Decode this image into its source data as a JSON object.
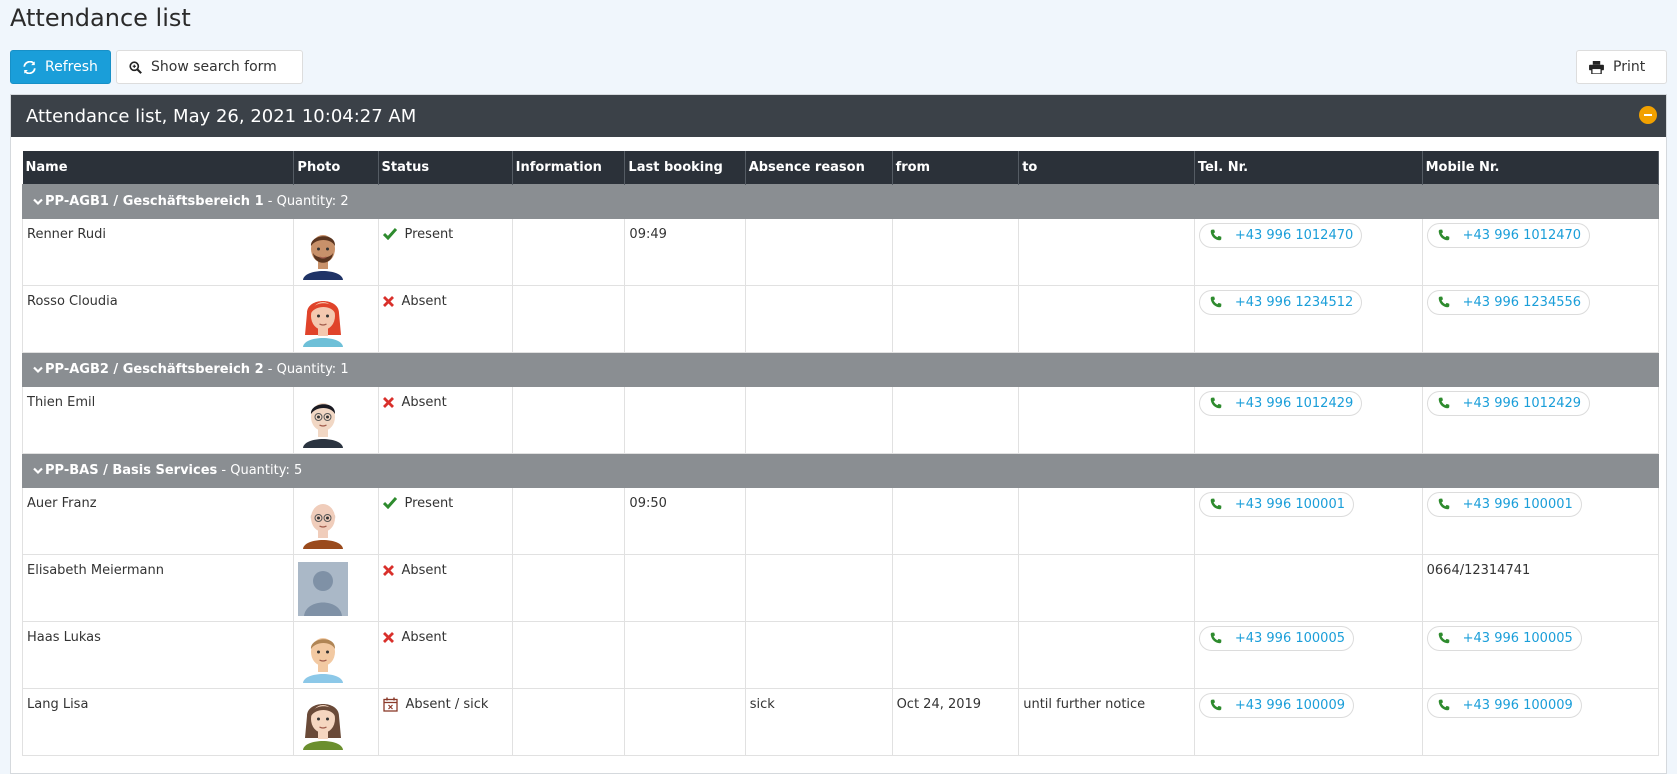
{
  "page": {
    "title": "Attendance list"
  },
  "toolbar": {
    "refresh_label": "Refresh",
    "search_label": "Show search form",
    "print_label": "Print"
  },
  "panel": {
    "title": "Attendance list, May 26, 2021 10:04:27 AM"
  },
  "colors": {
    "accent": "#1a9ed9",
    "header_dark": "#3b4148",
    "table_header": "#2b3139",
    "group_row": "#8a8e92",
    "present": "#2e8b2e",
    "absent": "#d9302b",
    "collapse": "#f2a100"
  },
  "table": {
    "columns": [
      "Name",
      "Photo",
      "Status",
      "Information",
      "Last booking",
      "Absence reason",
      "from",
      "to",
      "Tel. Nr.",
      "Mobile Nr."
    ],
    "groups": [
      {
        "name": "PP-AGB1 / Geschäftsbereich 1",
        "quantity": " - Quantity: 2",
        "rows": [
          {
            "name": "Renner Rudi",
            "avatar": "man-brown",
            "status": "Present",
            "status_icon": "check-icon",
            "information": "",
            "last_booking": "09:49",
            "reason": "",
            "from": "",
            "to": "",
            "tel": "+43 996 1012470",
            "mobile": "+43 996 1012470"
          },
          {
            "name": "Rosso Cloudia",
            "avatar": "woman-red",
            "status": "Absent",
            "status_icon": "x-icon",
            "information": "",
            "last_booking": "",
            "reason": "",
            "from": "",
            "to": "",
            "tel": "+43 996 1234512",
            "mobile": "+43 996 1234556"
          }
        ]
      },
      {
        "name": "PP-AGB2 / Geschäftsbereich 2",
        "quantity": " - Quantity: 1",
        "rows": [
          {
            "name": "Thien Emil",
            "avatar": "man-black",
            "status": "Absent",
            "status_icon": "x-icon",
            "information": "",
            "last_booking": "",
            "reason": "",
            "from": "",
            "to": "",
            "tel": "+43 996 1012429",
            "mobile": "+43 996 1012429"
          }
        ]
      },
      {
        "name": "PP-BAS / Basis Services",
        "quantity": " - Quantity: 5",
        "rows": [
          {
            "name": "Auer Franz",
            "avatar": "man-bald",
            "status": "Present",
            "status_icon": "check-icon",
            "information": "",
            "last_booking": "09:50",
            "reason": "",
            "from": "",
            "to": "",
            "tel": "+43 996 100001",
            "mobile": "+43 996 100001"
          },
          {
            "name": "Elisabeth Meiermann",
            "avatar": "placeholder",
            "status": "Absent",
            "status_icon": "x-icon",
            "information": "",
            "last_booking": "",
            "reason": "",
            "from": "",
            "to": "",
            "tel": "",
            "mobile": "0664/12314741"
          },
          {
            "name": "Haas Lukas",
            "avatar": "man-blond",
            "status": "Absent",
            "status_icon": "x-icon",
            "information": "",
            "last_booking": "",
            "reason": "",
            "from": "",
            "to": "",
            "tel": "+43 996 100005",
            "mobile": "+43 996 100005"
          },
          {
            "name": "Lang Lisa",
            "avatar": "woman-brown",
            "status": "Absent / sick",
            "status_icon": "calendar-x-icon",
            "information": "",
            "last_booking": "",
            "reason": "sick",
            "from": "Oct 24, 2019",
            "to": "until further notice",
            "tel": "+43 996 100009",
            "mobile": "+43 996 100009"
          }
        ]
      }
    ]
  }
}
